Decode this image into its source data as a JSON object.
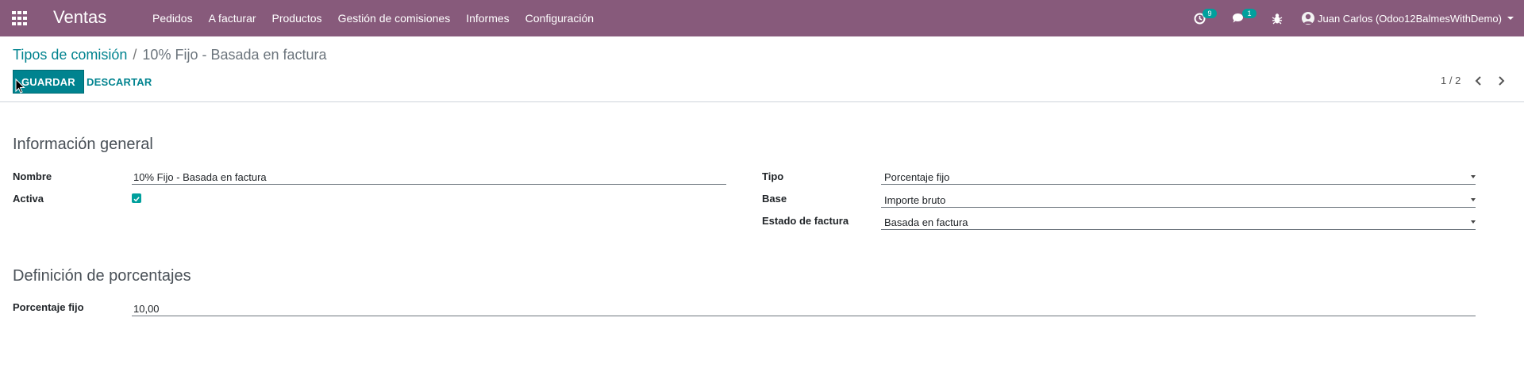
{
  "navbar": {
    "brand": "Ventas",
    "menu": [
      "Pedidos",
      "A facturar",
      "Productos",
      "Gestión de comisiones",
      "Informes",
      "Configuración"
    ],
    "activity_badge": "9",
    "messages_badge": "1",
    "user_name": "Juan Carlos (Odoo12BalmesWithDemo)",
    "icons": [
      "apps-icon",
      "activity-clock-icon",
      "messages-icon",
      "bug-icon",
      "avatar",
      "chevron-down-icon"
    ]
  },
  "control_panel": {
    "breadcrumb_parent": "Tipos de comisión",
    "breadcrumb_separator": "/",
    "breadcrumb_current": "10% Fijo - Basada en factura",
    "save_label": "GUARDAR",
    "discard_label": "DESCARTAR",
    "pager": "1 / 2"
  },
  "form": {
    "general_title": "Información general",
    "name_label": "Nombre",
    "name_value": "10% Fijo - Basada en factura",
    "active_label": "Activa",
    "active_checked": true,
    "type_label": "Tipo",
    "type_value": "Porcentaje fijo",
    "base_label": "Base",
    "base_value": "Importe bruto",
    "invoice_state_label": "Estado de factura",
    "invoice_state_value": "Basada en factura",
    "percentages_title": "Definición de porcentajes",
    "fixed_pct_label": "Porcentaje fijo",
    "fixed_pct_value": "10,00"
  },
  "colors": {
    "navbar": "#875a7b",
    "primary": "#00838f",
    "checkbox": "#00a09d"
  }
}
